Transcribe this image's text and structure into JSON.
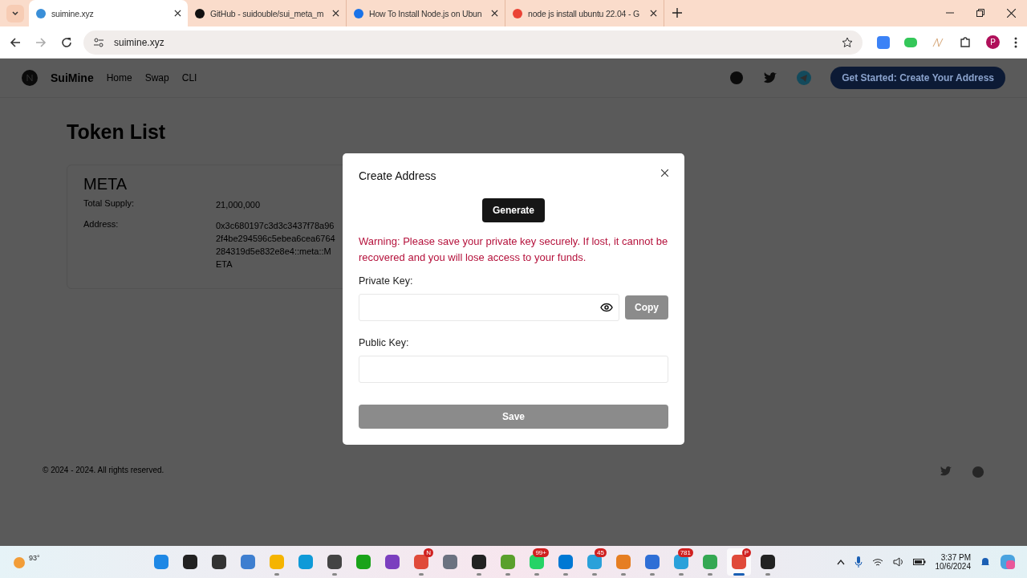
{
  "browser": {
    "tabs": [
      {
        "title": "suimine.xyz",
        "selected": true
      },
      {
        "title": "GitHub - suidouble/sui_meta_m",
        "selected": false
      },
      {
        "title": "How To Install Node.js on Ubun",
        "selected": false
      },
      {
        "title": "node js install ubuntu 22.04 - G",
        "selected": false
      }
    ],
    "url": "suimine.xyz",
    "profile_initial": "P"
  },
  "site": {
    "brand": "SuiMine",
    "nav": [
      "Home",
      "Swap",
      "CLI"
    ],
    "cta": "Get Started: Create Your Address"
  },
  "page": {
    "title": "Token List",
    "token": {
      "name": "META",
      "fields": [
        {
          "label": "Total Supply:",
          "value": "21,000,000"
        },
        {
          "label": "Address:",
          "value": "0x3c680197c3d3c3437f78a962f4be294596c5ebea6cea6764284319d5e832e8e4::meta::META"
        }
      ]
    }
  },
  "footer": {
    "copyright": "© 2024 - 2024. All rights reserved."
  },
  "modal": {
    "title": "Create Address",
    "generate": "Generate",
    "warning": "Warning: Please save your private key securely. If lost, it cannot be recovered and you will lose access to your funds.",
    "private_label": "Private Key:",
    "copy": "Copy",
    "public_label": "Public Key:",
    "save": "Save"
  },
  "taskbar": {
    "weather": "93°",
    "apps": [
      {
        "running": false,
        "selected": false
      },
      {
        "running": false,
        "selected": false
      },
      {
        "running": false,
        "selected": false
      },
      {
        "running": false,
        "selected": false
      },
      {
        "running": true,
        "selected": false
      },
      {
        "running": false,
        "selected": false
      },
      {
        "running": true,
        "selected": false
      },
      {
        "running": false,
        "selected": false
      },
      {
        "running": false,
        "selected": false
      },
      {
        "badge": "N",
        "running": true,
        "selected": false
      },
      {
        "running": false,
        "selected": false
      },
      {
        "running": true,
        "selected": false
      },
      {
        "running": true,
        "selected": false
      },
      {
        "badge": "99+",
        "running": true,
        "selected": false
      },
      {
        "running": true,
        "selected": false
      },
      {
        "badge": "45",
        "running": true,
        "selected": false
      },
      {
        "running": true,
        "selected": false
      },
      {
        "running": true,
        "selected": false
      },
      {
        "badge": "781",
        "running": true,
        "selected": false
      },
      {
        "running": true,
        "selected": false
      },
      {
        "badge": "P",
        "running": true,
        "selected": true
      },
      {
        "running": true,
        "selected": false
      }
    ],
    "time": "3:37 PM",
    "date": "10/6/2024"
  }
}
